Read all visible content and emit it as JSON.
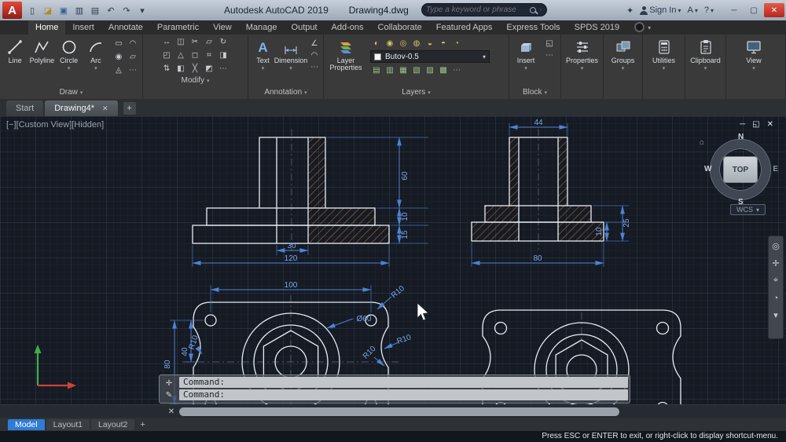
{
  "titlebar": {
    "app_name": "Autodesk AutoCAD 2019",
    "doc_name": "Drawing4.dwg",
    "search_placeholder": "Type a keyword or phrase",
    "sign_in": "Sign In",
    "window": {
      "minimize": "─",
      "maximize": "▢",
      "close": "✕"
    }
  },
  "icons": {
    "caret": "▾",
    "qat": [
      "▯",
      "◪",
      "▣",
      "▥",
      "▤",
      "↶",
      "↷",
      "▾"
    ],
    "titlebar_right": [
      "✦",
      "A",
      "?"
    ],
    "draw_extra": [
      "▭",
      "◠",
      "◉",
      "▱",
      "◬",
      "⋯"
    ],
    "modify_grid": [
      "↔",
      "◫",
      "✂",
      "▱",
      "↻",
      "◰",
      "△",
      "◻",
      "⌗",
      "◨",
      "⇅",
      "◧",
      "╳",
      "◩",
      "⋯"
    ],
    "annotation_extra": [
      "∠",
      "◠",
      "⋯"
    ],
    "layers_row1": [
      "◐",
      "◉",
      "◎",
      "◍",
      "◒",
      "◓",
      "◔"
    ],
    "layers_row2": [
      "▤",
      "▥",
      "▦",
      "▧",
      "▨",
      "▩",
      "⋯"
    ],
    "block_extra": [
      "◱",
      "⋯"
    ],
    "navbar": [
      "◎",
      "✛",
      "⌖",
      "◔",
      "▾"
    ],
    "cmd_side": [
      "✛",
      "✎"
    ],
    "scroll_icons": [
      "✕",
      "✛"
    ],
    "viewcube_home": "⌂"
  },
  "ribbon": {
    "tabs": [
      "Home",
      "Insert",
      "Annotate",
      "Parametric",
      "View",
      "Manage",
      "Output",
      "Add-ons",
      "Collaborate",
      "Featured Apps",
      "Express Tools",
      "SPDS 2019"
    ],
    "panels": {
      "draw": {
        "label": "Draw",
        "line": "Line",
        "polyline": "Polyline",
        "circle": "Circle",
        "arc": "Arc"
      },
      "modify": {
        "label": "Modify"
      },
      "annotation": {
        "label": "Annotation",
        "text": "Text",
        "dimension": "Dimension"
      },
      "layers": {
        "label": "Layers",
        "layer_properties": "Layer Properties",
        "current_layer": "Butov-0.5"
      },
      "block": {
        "label": "Block",
        "insert": "Insert"
      },
      "properties": "Properties",
      "groups": "Groups",
      "utilities": "Utilities",
      "clipboard": "Clipboard",
      "view": "View"
    }
  },
  "file_tabs": {
    "start": "Start",
    "drawing": "Drawing4*",
    "close": "✕",
    "add": "+"
  },
  "viewport": {
    "header": "[−][Custom View][Hidden]",
    "controls": [
      "─",
      "◱",
      "✕"
    ],
    "viewcube": {
      "n": "N",
      "w": "W",
      "s": "S",
      "e": "E",
      "top": "TOP"
    },
    "wcs": "WCS"
  },
  "command": {
    "line1": "Command:",
    "line2": "Command:"
  },
  "layout_bar": {
    "model": "Model",
    "layout1": "Layout1",
    "layout2": "Layout2",
    "add": "+"
  },
  "status": {
    "message": "Press ESC or ENTER to exit, or right-click to display shortcut-menu."
  },
  "drawing": {
    "front": {
      "d30": "30",
      "d120": "120",
      "d60": "60",
      "d10": "10",
      "d15": "15"
    },
    "side": {
      "d44": "44",
      "d80": "80",
      "d25": "25",
      "d10": "10"
    },
    "plan": {
      "d100": "100",
      "d80": "80",
      "d40": "40",
      "dia": "Ø60",
      "r": [
        "R10",
        "R10",
        "R10",
        "R10"
      ]
    }
  },
  "colors": {
    "dim_blue": "#4d82d6",
    "hatch_orange": "#b5722e",
    "model_tab": "#2e7cd6"
  }
}
